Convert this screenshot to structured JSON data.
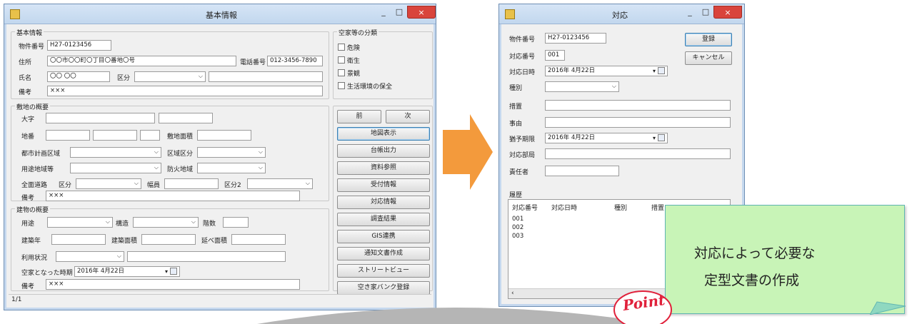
{
  "basic_window": {
    "title": "基本情報",
    "controls": {
      "minimize": "_",
      "maximize": "□",
      "close": "×"
    },
    "group_basic": {
      "title": "基本情報",
      "property_no_label": "物件番号",
      "property_no_value": "H27-0123456",
      "address_label": "住所",
      "address_value": "〇〇市〇〇町〇丁目〇番地〇号",
      "phone_label": "電話番号",
      "phone_value": "012-3456-7890",
      "name_label": "氏名",
      "name_value": "〇〇 〇〇",
      "category_label": "区分",
      "remarks_label": "備考",
      "remarks_value": "×××"
    },
    "group_classification": {
      "title": "空家等の分類",
      "options": [
        "危険",
        "衛生",
        "景観",
        "生活環境の保全"
      ]
    },
    "group_site": {
      "title": "敷地の概要",
      "oaza_label": "大字",
      "lot_label": "地番",
      "site_area_label": "敷地面積",
      "city_plan_label": "都市計画区域",
      "zone_class_label": "区域区分",
      "use_zone_label": "用途地域等",
      "fire_zone_label": "防火地域",
      "front_road_label": "全面道路",
      "road_class_label": "区分",
      "width_label": "幅員",
      "class2_label": "区分2",
      "remarks_label": "備考",
      "remarks_value": "×××"
    },
    "group_building": {
      "title": "建物の概要",
      "use_label": "用途",
      "structure_label": "構造",
      "floors_label": "階数",
      "built_year_label": "建築年",
      "building_area_label": "建築面積",
      "floor_area_label": "延べ面積",
      "usage_label": "利用状況",
      "vacant_since_label": "空家となった時期",
      "vacant_since_value": "2016年  4月22日",
      "remarks_label": "備考",
      "remarks_value": "×××"
    },
    "buttons": {
      "prev": "前",
      "next": "次",
      "map": "地図表示",
      "ledger": "台帳出力",
      "docs": "資料参照",
      "reception": "受付情報",
      "response": "対応情報",
      "survey": "調査結果",
      "gis": "GIS連携",
      "notice": "通知文書作成",
      "street": "ストリートビュー",
      "bank": "空き家バンク登録"
    },
    "status_text": "1/1"
  },
  "response_window": {
    "title": "対応",
    "controls": {
      "minimize": "_",
      "maximize": "□",
      "close": "×"
    },
    "property_no_label": "物件番号",
    "property_no_value": "H27-0123456",
    "response_no_label": "対応番号",
    "response_no_value": "001",
    "response_date_label": "対応日時",
    "response_date_value": "2016年  4月22日",
    "type_label": "種別",
    "measure_label": "措置",
    "reason_label": "事由",
    "grace_label": "猶予期限",
    "grace_value": "2016年  4月22日",
    "department_label": "対応部局",
    "person_label": "責任者",
    "register_button": "登録",
    "cancel_button": "キャンセル",
    "history_label": "履歴",
    "history_columns": [
      "対応番号",
      "対応日時",
      "種別",
      "措置"
    ],
    "history_rows": [
      "001",
      "002",
      "003"
    ]
  },
  "callout": {
    "line1": "対応によって必要な",
    "line2": "定型文書の作成",
    "badge": "Point",
    "colors": {
      "fill": "#c8f4b7",
      "border": "#5fb5b2",
      "badge": "#e0213b"
    }
  },
  "arrow_color": "#f39a3c"
}
